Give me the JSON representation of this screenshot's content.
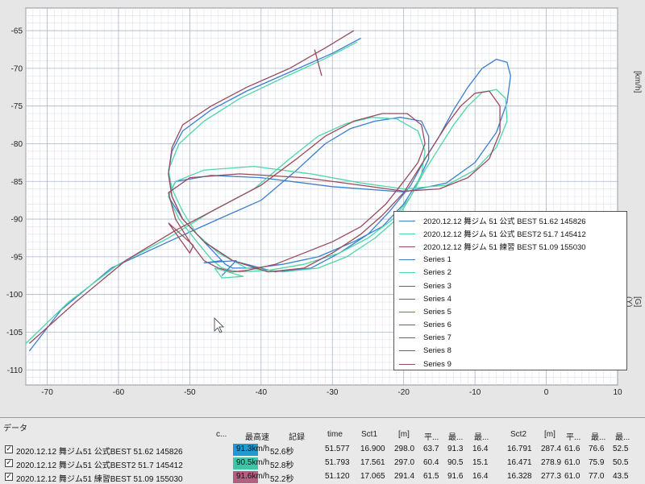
{
  "chart_data": {
    "type": "line",
    "xlim": [
      -73,
      10
    ],
    "ylim": [
      -112,
      -62
    ],
    "x_ticks": [
      -70,
      -60,
      -50,
      -40,
      -30,
      -20,
      -10,
      0,
      10
    ],
    "y_ticks": [
      -65,
      -70,
      -75,
      -80,
      -85,
      -90,
      -95,
      -100,
      -105,
      -110
    ],
    "grid": true,
    "legend_placement": "bottom-right",
    "right_axis_labels": [
      "[km/h]",
      "[G] (Y)"
    ],
    "legend": [
      {
        "label": "2020.12.12  舞ジム 51 公式 BEST 51.62  145826",
        "color": "#3a7fd0"
      },
      {
        "label": "2020.12.12  舞ジム 51 公式 BEST2 51.7  145412",
        "color": "#4fd6a8"
      },
      {
        "label": "2020.12.12  舞ジム 51 練習 BEST 51.09  155030",
        "color": "#9a4a5e"
      },
      {
        "label": "Series 1",
        "color": "#3a7fd0"
      },
      {
        "label": "Series 2",
        "color": "#4fd6a8"
      },
      {
        "label": "Series 3",
        "color": "#9a4a5e"
      },
      {
        "label": "Series 4",
        "color": "#9a4a5e"
      },
      {
        "label": "Series 5",
        "color": "#3a7fd0"
      },
      {
        "label": "Series 6",
        "color": "#9a4a5e"
      },
      {
        "label": "Series 7",
        "color": "#9a4a5e"
      },
      {
        "label": "Series 8",
        "color": "#9a4a5e"
      },
      {
        "label": "Series 9",
        "color": "#9a4a5e"
      }
    ],
    "series": [
      {
        "name": "2020.12.12  舞ジム 51 公式 BEST 51.62  145826",
        "color": "#3a7fd0",
        "x": [
          -26,
          -30,
          -36,
          -42,
          -47,
          -51,
          -52.5,
          -53,
          -52.5,
          -51,
          -48,
          -44,
          -38,
          -33,
          -29,
          -25,
          -22,
          -19,
          -17,
          -15,
          -13,
          -11,
          -9,
          -7,
          -5.5,
          -5,
          -5.5,
          -7,
          -10,
          -14,
          -20,
          -30,
          -40,
          -47,
          -52,
          -53,
          -51,
          -48,
          -46,
          -45,
          -44,
          -41,
          -37,
          -32,
          -27,
          -23,
          -20,
          -18,
          -16.5,
          -16.5,
          -17.5,
          -20.5,
          -24,
          -27.5,
          -31,
          -35,
          -40,
          -46,
          -53,
          -61,
          -68,
          -72.5
        ],
        "y": [
          -66,
          -68,
          -70.5,
          -73,
          -75.5,
          -78.3,
          -81,
          -84,
          -87,
          -90,
          -93,
          -95.5,
          -97,
          -96.5,
          -94.5,
          -92,
          -89,
          -85.5,
          -82,
          -79,
          -75.5,
          -72.5,
          -70,
          -68.8,
          -69.2,
          -71,
          -74.5,
          -78.5,
          -82.5,
          -85.2,
          -86.4,
          -85.7,
          -84.5,
          -84.2,
          -85,
          -87,
          -90,
          -93,
          -95,
          -96,
          -96.5,
          -96.5,
          -96,
          -95,
          -93,
          -91,
          -88,
          -85,
          -82,
          -79,
          -77,
          -76.5,
          -77,
          -78,
          -80,
          -83.5,
          -87.5,
          -90,
          -93,
          -96.5,
          -102,
          -107.5
        ]
      },
      {
        "name": "2020.12.12  舞ジム 51 公式 BEST2 51.7  145412",
        "color": "#4fd6a8",
        "x": [
          -26.5,
          -31,
          -37,
          -43,
          -48,
          -51.5,
          -53,
          -52.5,
          -51,
          -49,
          -46,
          -42,
          -37,
          -32,
          -28,
          -24,
          -21,
          -19,
          -17,
          -15,
          -13,
          -11,
          -9,
          -7,
          -5.7,
          -5.5,
          -7,
          -10,
          -14,
          -20,
          -26,
          -33,
          -41,
          -48,
          -52,
          -53,
          -51.5,
          -49,
          -47,
          -45.5,
          -43,
          -39,
          -34,
          -29,
          -25,
          -21.5,
          -19,
          -17.5,
          -17,
          -18,
          -21,
          -24.5,
          -28,
          -32,
          -36,
          -41,
          -47,
          -53,
          -60,
          -67,
          -73
        ],
        "y": [
          -66.5,
          -68.7,
          -71.3,
          -74,
          -77,
          -80,
          -83.5,
          -86,
          -89,
          -92,
          -94.5,
          -96.5,
          -97,
          -96.5,
          -95,
          -92.5,
          -90,
          -87,
          -83.5,
          -80.5,
          -77.5,
          -75,
          -73.2,
          -72.8,
          -74,
          -77,
          -80.5,
          -83.5,
          -85.5,
          -86,
          -85.2,
          -84,
          -83,
          -83.5,
          -85,
          -87,
          -90,
          -93,
          -95.3,
          -96.5,
          -97,
          -96.8,
          -96,
          -94.5,
          -92.5,
          -90,
          -87,
          -84,
          -81,
          -78.3,
          -76.7,
          -76.5,
          -77.3,
          -79,
          -82,
          -86,
          -89,
          -92.5,
          -96,
          -101,
          -106.5
        ]
      },
      {
        "name": "2020.12.12  舞ジム 51 練習 BEST 51.09  155030",
        "color": "#9a4a5e",
        "x": [
          -27,
          -31,
          -36,
          -42,
          -47,
          -51,
          -52.5,
          -53,
          -52.5,
          -51,
          -48,
          -44,
          -39,
          -34,
          -30,
          -26,
          -23,
          -20,
          -18,
          -16,
          -14,
          -12,
          -10,
          -8,
          -6.5,
          -6.5,
          -8,
          -11,
          -15,
          -20,
          -26,
          -34,
          -43,
          -50,
          -53,
          -52,
          -50,
          -48,
          -46,
          -44,
          -42,
          -38,
          -34,
          -30,
          -26,
          -22.5,
          -20,
          -18,
          -17,
          -17.5,
          -19.5,
          -23,
          -27,
          -31,
          -35,
          -40,
          -46,
          -52,
          -59,
          -66,
          -72.5
        ],
        "y": [
          -65,
          -67.3,
          -70,
          -72.5,
          -75,
          -77.5,
          -80.5,
          -84,
          -87,
          -90,
          -93,
          -95.5,
          -97,
          -96.5,
          -94.5,
          -92,
          -89.5,
          -86.5,
          -83.5,
          -80.5,
          -77.5,
          -75,
          -73.3,
          -73,
          -75,
          -78.5,
          -82,
          -84.5,
          -86,
          -86.3,
          -85.5,
          -84.5,
          -84,
          -84.5,
          -86.5,
          -90,
          -93,
          -95.5,
          -96.5,
          -97,
          -96.8,
          -96,
          -94.5,
          -93,
          -91,
          -88,
          -85,
          -82.5,
          -80,
          -77.5,
          -76,
          -76,
          -77,
          -79,
          -82,
          -85.5,
          -88.5,
          -91.5,
          -95.5,
          -101,
          -106.5
        ]
      },
      {
        "name": "Series 1",
        "color": "#3a7fd0",
        "x": [
          -45.5,
          -48,
          -43.5,
          -45.5
        ],
        "y": [
          -95.5,
          -95.8,
          -95.5,
          -97.5
        ]
      },
      {
        "name": "Series 2",
        "color": "#4fd6a8",
        "x": [
          -46.5,
          -45.5,
          -42.5,
          -46.5
        ],
        "y": [
          -96.5,
          -97.8,
          -97.6,
          -96.5
        ]
      },
      {
        "name": "Series 3",
        "color": "#9a4a5e",
        "x": [
          -32.5,
          -31.5
        ],
        "y": [
          -67.5,
          -71
        ]
      },
      {
        "name": "Series 4",
        "color": "#9a4a5e",
        "x": [
          -53,
          -50,
          -49.5,
          -53
        ],
        "y": [
          -90.5,
          -94.5,
          -93.5,
          -90.5
        ]
      }
    ]
  },
  "side_labels": {
    "km_h": "[km/h]",
    "g_y": "[G] (Y)"
  },
  "data_panel": {
    "title": "データ",
    "headers": [
      "c...",
      "最高速",
      "記録",
      "time",
      "Sct1",
      "[m]",
      "平...",
      "最...",
      "最...",
      "Sct2",
      "[m]",
      "平...",
      "最...",
      "最..."
    ],
    "rows": [
      {
        "name": "2020.12.12  舞ジム51 公式BEST 51.62   145826",
        "color": "#1e9ad0",
        "color_text": "91.3km/h",
        "record": "52.6秒",
        "time": "51.577",
        "sct1": "16.900",
        "m1": "298.0",
        "avg1": "63.7",
        "max1": "91.3",
        "min1": "16.4",
        "sct2": "16.791",
        "m2": "287.4",
        "avg2": "61.6",
        "max2": "76.6",
        "min2": "52.5"
      },
      {
        "name": "2020.12.12  舞ジム51 公式BEST2 51.7   145412",
        "color": "#3cc8a8",
        "color_text": "90.5km/h",
        "record": "52.8秒",
        "time": "51.793",
        "sct1": "17.561",
        "m1": "297.0",
        "avg1": "60.4",
        "max1": "90.5",
        "min1": "15.1",
        "sct2": "16.471",
        "m2": "278.9",
        "avg2": "61.0",
        "max2": "75.9",
        "min2": "50.5"
      },
      {
        "name": "2020.12.12  舞ジム51 練習BEST 51.09   155030",
        "color": "#b06080",
        "color_text": "91.6km/h",
        "record": "52.2秒",
        "time": "51.120",
        "sct1": "17.065",
        "m1": "291.4",
        "avg1": "61.5",
        "max1": "91.6",
        "min1": "16.4",
        "sct2": "16.328",
        "m2": "277.3",
        "avg2": "61.0",
        "max2": "77.0",
        "min2": "43.5"
      }
    ]
  }
}
